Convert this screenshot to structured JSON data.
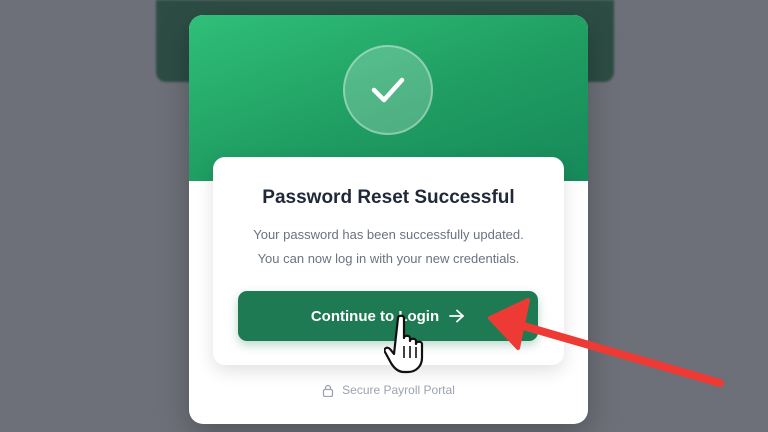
{
  "dialog": {
    "title": "Password Reset Successful",
    "message_line1": "Your password has been successfully updated.",
    "message_line2": "You can now log in with your new credentials.",
    "button_label": "Continue to Login",
    "footer_text": "Secure Payroll Portal"
  },
  "icons": {
    "status": "check-icon",
    "button": "arrow-right-icon",
    "footer": "lock-icon",
    "pointer": "hand-pointer-icon"
  },
  "colors": {
    "header_green": "#1f9d62",
    "button_green": "#1e7a52",
    "annotation_red": "#ee3a35"
  }
}
